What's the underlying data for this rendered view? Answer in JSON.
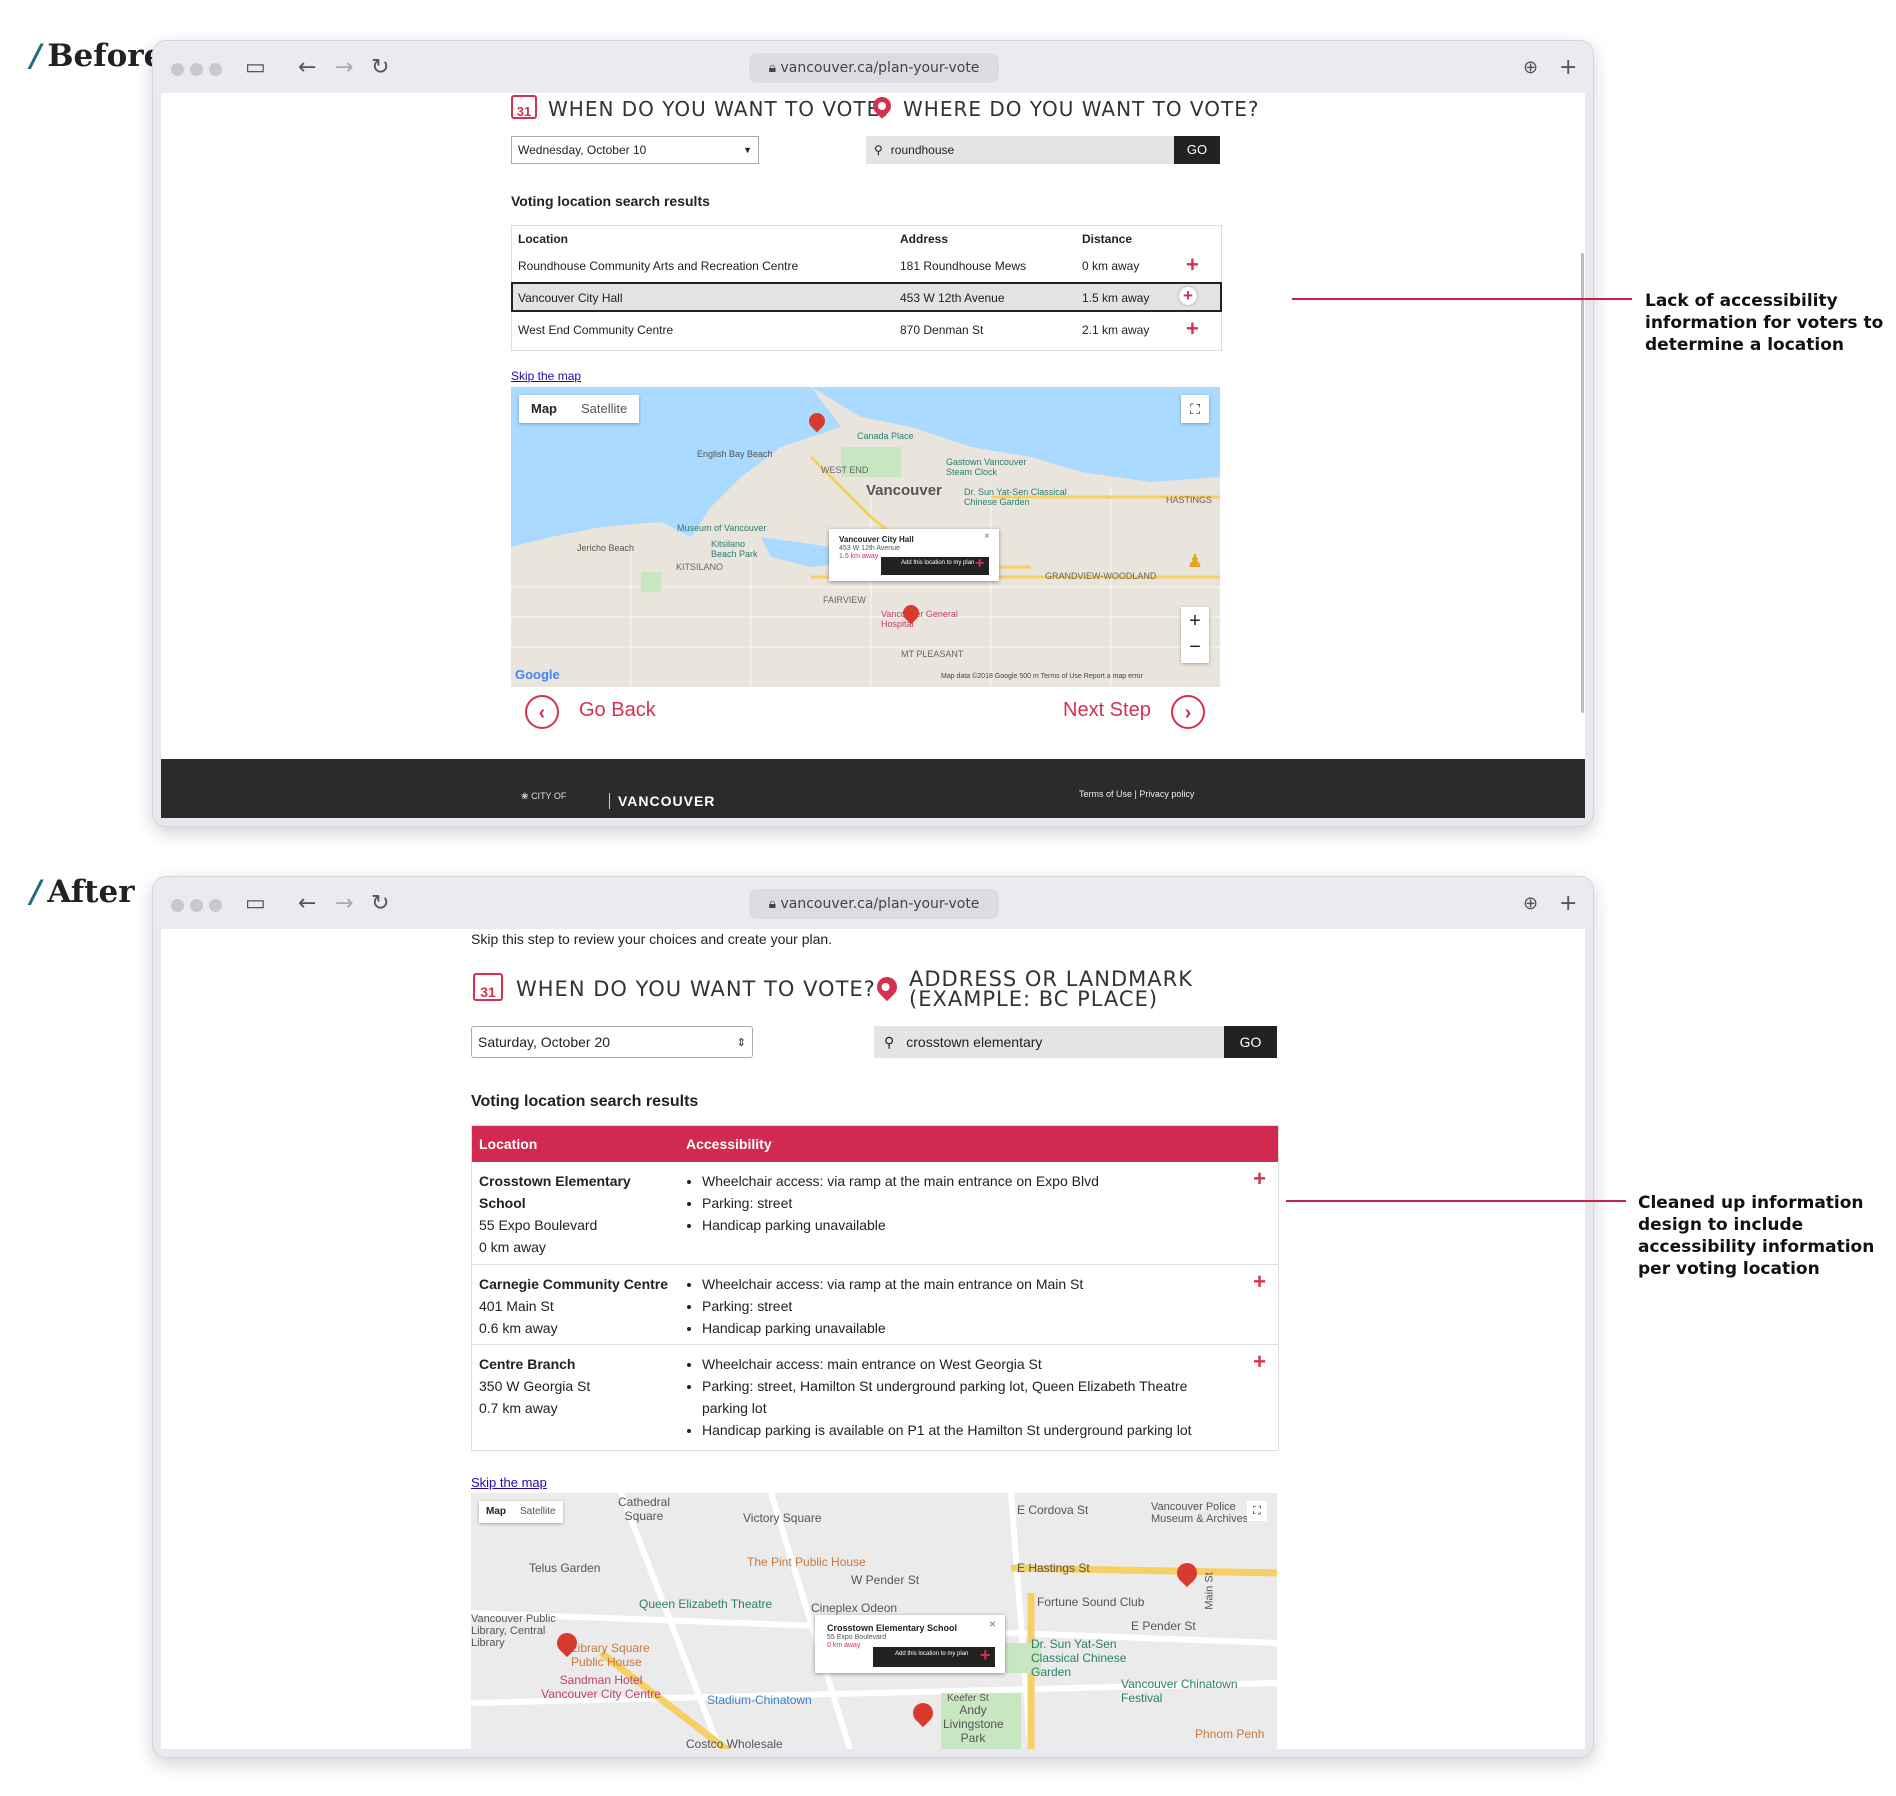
{
  "labels": {
    "before": "Before",
    "after": "After"
  },
  "browser": {
    "url": "vancouver.ca/plan-your-vote"
  },
  "before": {
    "when_heading": "WHEN DO YOU WANT TO VOTE?",
    "where_heading": "WHERE DO YOU WANT TO VOTE?",
    "calendar_day": "31",
    "date_value": "Wednesday, October 10",
    "search_value": "roundhouse",
    "go_label": "GO",
    "results_title": "Voting location search results",
    "columns": [
      "Location",
      "Address",
      "Distance"
    ],
    "rows": [
      {
        "location": "Roundhouse Community Arts and Recreation Centre",
        "address": "181 Roundhouse Mews",
        "distance": "0 km away"
      },
      {
        "location": "Vancouver City Hall",
        "address": "453 W 12th Avenue",
        "distance": "1.5 km away"
      },
      {
        "location": "West End Community Centre",
        "address": "870 Denman St",
        "distance": "2.1 km away"
      }
    ],
    "skip_map": "Skip the map",
    "map_tabs": [
      "Map",
      "Satellite"
    ],
    "map_labels": [
      "Vancouver",
      "WEST END",
      "KITSILANO",
      "FAIRVIEW",
      "MT PLEASANT",
      "GRANDVIEW-WOODLAND",
      "HASTINGS",
      "English Bay Beach",
      "Canada Place",
      "Jericho Beach",
      "Kitsilano Beach Park",
      "Museum of Vancouver",
      "Gastown Vancouver Steam Clock",
      "Dr. Sun Yat-Sen Classical Chinese Garden",
      "Vancouver General Hospital"
    ],
    "callout": {
      "title": "Vancouver City Hall",
      "address": "453 W 12th Avenue",
      "distance": "1.5 km away",
      "add": "Add this location to my plan"
    },
    "map_footer": "Map data ©2018 Google   500 m   Terms of Use   Report a map error",
    "google": "Google",
    "go_back": "Go Back",
    "next_step": "Next Step",
    "footer_city": "CITY OF",
    "footer_vancouver": "VANCOUVER",
    "footer_links": "Terms of Use | Privacy policy",
    "annotation": "Lack of accessibility information for voters to determine a location"
  },
  "after": {
    "skip_step": "Skip this step to review your choices and create your plan.",
    "when_heading": "WHEN DO YOU WANT TO VOTE?",
    "where_heading_1": "ADDRESS OR LANDMARK",
    "where_heading_2": "(EXAMPLE: BC PLACE)",
    "calendar_day": "31",
    "date_value": "Saturday, October 20",
    "search_value": "crosstown elementary",
    "go_label": "GO",
    "results_title": "Voting location search results",
    "columns": [
      "Location",
      "Accessibility"
    ],
    "rows": [
      {
        "name": "Crosstown Elementary School",
        "address": "55 Expo Boulevard",
        "distance": "0 km away",
        "bullets": [
          "Wheelchair access: via ramp at the main entrance on Expo Blvd",
          "Parking: street",
          "Handicap parking unavailable"
        ]
      },
      {
        "name": "Carnegie Community Centre",
        "address": "401 Main St",
        "distance": "0.6 km away",
        "bullets": [
          "Wheelchair access: via ramp at the main entrance on Main St",
          "Parking: street",
          "Handicap parking unavailable"
        ]
      },
      {
        "name": "Centre Branch",
        "address": "350 W Georgia St",
        "distance": "0.7 km away",
        "bullets": [
          "Wheelchair access: main entrance on West Georgia St",
          "Parking: street, Hamilton St underground parking lot, Queen Elizabeth Theatre parking lot",
          "Handicap parking is available on P1 at the Hamilton St underground parking lot"
        ]
      }
    ],
    "skip_map": "Skip the map",
    "map_tabs": [
      "Map",
      "Satellite"
    ],
    "map_labels": [
      "Cathedral Square",
      "Victory Square",
      "E Cordova St",
      "Vancouver Police Museum & Archives",
      "Telus Garden",
      "The Pint Public House",
      "W Pender St",
      "E Hastings St",
      "Queen Elizabeth Theatre",
      "Cineplex Odeon",
      "Fortune Sound Club",
      "Vancouver Public Library, Central Library",
      "Library Square Public House",
      "E Pender St",
      "Dr. Sun Yat-Sen Classical Chinese Garden",
      "Sandman Hotel Vancouver City Centre",
      "Stadium-Chinatown",
      "Andy Livingstone Park",
      "Vancouver Chinatown Festival",
      "Costco Wholesale",
      "Phnom Penh",
      "Main St",
      "Keefer St"
    ],
    "callout": {
      "title": "Crosstown Elementary School",
      "address": "55 Expo Boulevard",
      "distance": "0 km away",
      "add": "Add this location to my plan"
    },
    "annotation": "Cleaned up information design to include accessibility information per voting location"
  },
  "colors": {
    "accent": "#d6304f",
    "annotation_line": "#c2244b",
    "header_dark": "#2b2b2b"
  },
  "icons": [
    "calendar-icon",
    "location-pin-icon",
    "search-icon",
    "add-icon",
    "fullscreen-icon",
    "pegman-icon",
    "zoom-in-icon",
    "zoom-out-icon",
    "back-arrow-icon",
    "forward-arrow-icon",
    "reload-icon",
    "sidebar-icon",
    "lock-icon",
    "download-icon",
    "new-tab-icon"
  ]
}
